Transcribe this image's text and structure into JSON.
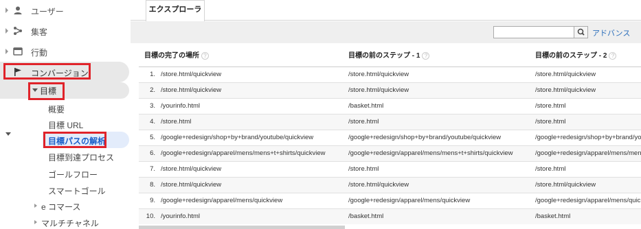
{
  "sidebar": {
    "items": [
      {
        "label": "ユーザー",
        "icon": "user-icon"
      },
      {
        "label": "集客",
        "icon": "acquisition-icon"
      },
      {
        "label": "行動",
        "icon": "behavior-icon"
      },
      {
        "label": "コンバージョン",
        "icon": "flag-icon"
      }
    ],
    "goal_label": "目標",
    "sub_items": [
      "概要",
      "目標 URL",
      "目標パスの解析",
      "目標到達プロセス",
      "ゴールフロー",
      "スマートゴール"
    ],
    "bottom_items": [
      "e コマース",
      "マルチチャネル"
    ],
    "highlight_color": "#e0232a",
    "active_color": "#1a5ec9"
  },
  "main": {
    "tab_label": "エクスプローラ",
    "advance_label": "アドバンス",
    "search_value": "",
    "columns": [
      "目標の完了の場所",
      "目標の前のステップ - 1",
      "目標の前のステップ - 2"
    ],
    "help_mark": "?",
    "rows": [
      {
        "n": "1.",
        "c1": "/store.html/quickview",
        "c2": "/store.html/quickview",
        "c3": "/store.html/quickview"
      },
      {
        "n": "2.",
        "c1": "/store.html/quickview",
        "c2": "/store.html/quickview",
        "c3": "/store.html/quickview"
      },
      {
        "n": "3.",
        "c1": "/yourinfo.html",
        "c2": "/basket.html",
        "c3": "/store.html"
      },
      {
        "n": "4.",
        "c1": "/store.html",
        "c2": "/store.html",
        "c3": "/store.html"
      },
      {
        "n": "5.",
        "c1": "/google+redesign/shop+by+brand/youtube/quickview",
        "c2": "/google+redesign/shop+by+brand/youtube/quickview",
        "c3": "/google+redesign/shop+by+brand/youtube/quickview"
      },
      {
        "n": "6.",
        "c1": "/google+redesign/apparel/mens/mens+t+shirts/quickview",
        "c2": "/google+redesign/apparel/mens/mens+t+shirts/quickview",
        "c3": "/google+redesign/apparel/mens/mens+t+shirts/quickview"
      },
      {
        "n": "7.",
        "c1": "/store.html/quickview",
        "c2": "/store.html",
        "c3": "/store.html"
      },
      {
        "n": "8.",
        "c1": "/store.html/quickview",
        "c2": "/store.html/quickview",
        "c3": "/store.html/quickview"
      },
      {
        "n": "9.",
        "c1": "/google+redesign/apparel/mens/quickview",
        "c2": "/google+redesign/apparel/mens/quickview",
        "c3": "/google+redesign/apparel/mens/quickview"
      },
      {
        "n": "10.",
        "c1": "/yourinfo.html",
        "c2": "/basket.html",
        "c3": "/basket.html"
      }
    ]
  }
}
